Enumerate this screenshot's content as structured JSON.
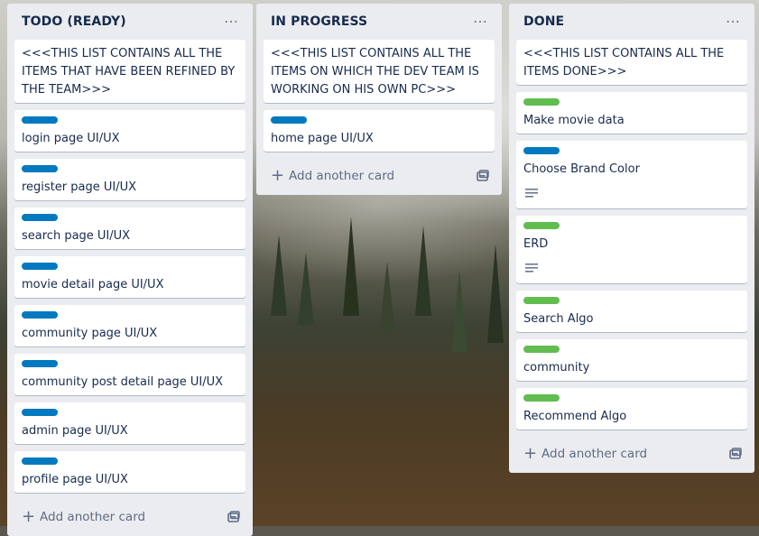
{
  "lists": [
    {
      "title": "TODO (READY)",
      "add_label": "Add another card",
      "cards": [
        {
          "title": "<<<THIS LIST CONTAINS ALL THE ITEMS THAT HAVE BEEN REFINED BY THE TEAM>>>"
        },
        {
          "label": "blue",
          "title": "login page UI/UX"
        },
        {
          "label": "blue",
          "title": "register page UI/UX"
        },
        {
          "label": "blue",
          "title": "search page UI/UX"
        },
        {
          "label": "blue",
          "title": "movie detail page UI/UX"
        },
        {
          "label": "blue",
          "title": "community page UI/UX"
        },
        {
          "label": "blue",
          "title": "community post detail page UI/UX"
        },
        {
          "label": "blue",
          "title": "admin page UI/UX"
        },
        {
          "label": "blue",
          "title": "profile page UI/UX"
        }
      ]
    },
    {
      "title": "IN PROGRESS",
      "add_label": "Add another card",
      "cards": [
        {
          "title": "<<<THIS LIST CONTAINS ALL THE ITEMS ON WHICH THE DEV TEAM IS WORKING ON HIS OWN PC>>>"
        },
        {
          "label": "blue",
          "title": "home page UI/UX"
        }
      ]
    },
    {
      "title": "DONE",
      "add_label": "Add another card",
      "cards": [
        {
          "title": "<<<THIS LIST CONTAINS ALL THE ITEMS DONE>>>"
        },
        {
          "label": "green",
          "title": "Make movie data"
        },
        {
          "label": "blue",
          "title": "Choose Brand Color",
          "has_description": true
        },
        {
          "label": "green",
          "title": "ERD",
          "has_description": true
        },
        {
          "label": "green",
          "title": "Search Algo"
        },
        {
          "label": "green",
          "title": "community"
        },
        {
          "label": "green",
          "title": "Recommend Algo"
        }
      ]
    }
  ],
  "colors": {
    "list_bg": "#ebecf0",
    "label_blue": "#0079bf",
    "label_green": "#61bd4f",
    "text": "#172b4d",
    "muted": "#5e6c84"
  },
  "icons": {
    "list_menu": "ellipsis-icon",
    "add": "plus-icon",
    "template": "card-template-icon",
    "description": "description-icon"
  }
}
